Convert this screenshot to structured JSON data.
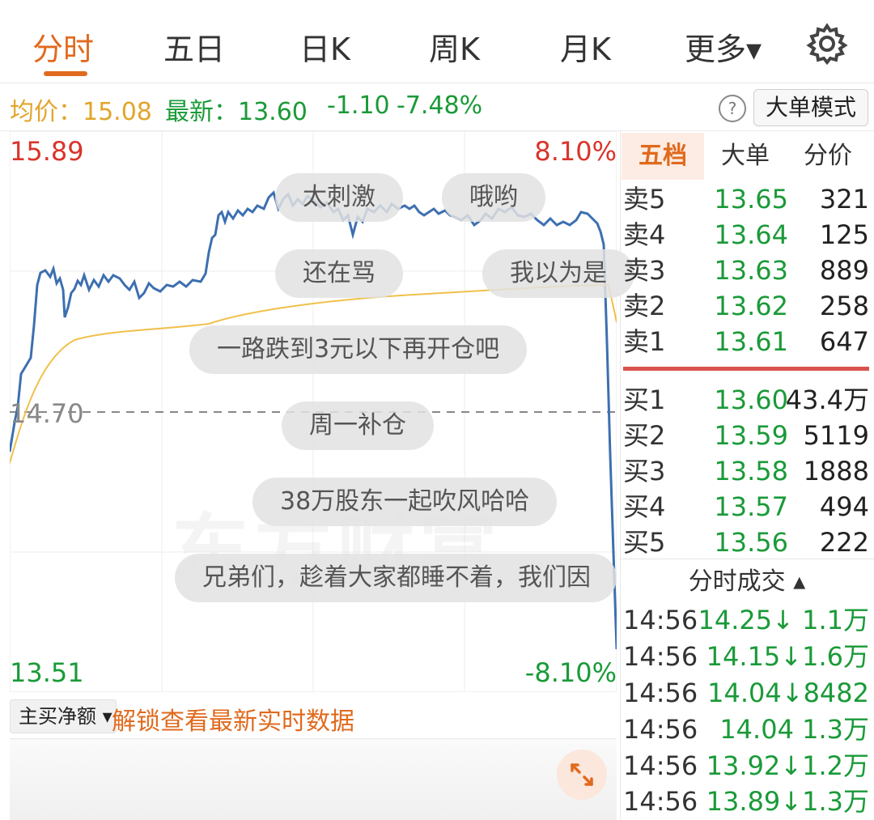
{
  "tabs": [
    {
      "label": "分时",
      "active": true
    },
    {
      "label": "五日"
    },
    {
      "label": "日K"
    },
    {
      "label": "周K"
    },
    {
      "label": "月K"
    },
    {
      "label": "更多▾"
    }
  ],
  "info": {
    "avg_label": "均价：15.08",
    "latest_label": "最新：13.60",
    "change": "-1.10",
    "change_pct": "-7.48%",
    "help": "?",
    "big_order_mode": "大单模式"
  },
  "chart": {
    "price_high": "15.89",
    "pct_high": "8.10%",
    "price_mid": "14.70",
    "price_low": "13.51",
    "pct_low": "-8.10%",
    "watermark": "东方财富",
    "colors": {
      "price_line": "#3d6fb0",
      "avg_line": "#f0c04a",
      "up": "#d9342b",
      "down": "#1a9a38"
    }
  },
  "danmu": [
    "太刺激",
    "哦哟",
    "还在骂",
    "我以为是",
    "一路跌到3元以下再开仓吧",
    "周一补仓",
    "38万股东一起吹风哈哈",
    "兄弟们，趁着大家都睡不着，我们因"
  ],
  "bottom": {
    "net_buy_label": "主买净额 ▾",
    "unlock_text": "解锁查看最新实时数据"
  },
  "right_tabs": [
    {
      "label": "五档",
      "active": true
    },
    {
      "label": "大单"
    },
    {
      "label": "分价"
    }
  ],
  "sell_orders": [
    {
      "label": "卖5",
      "price": "13.65",
      "vol": "321"
    },
    {
      "label": "卖4",
      "price": "13.64",
      "vol": "125"
    },
    {
      "label": "卖3",
      "price": "13.63",
      "vol": "889"
    },
    {
      "label": "卖2",
      "price": "13.62",
      "vol": "258"
    },
    {
      "label": "卖1",
      "price": "13.61",
      "vol": "647"
    }
  ],
  "buy_orders": [
    {
      "label": "买1",
      "price": "13.60",
      "vol": "43.4万"
    },
    {
      "label": "买2",
      "price": "13.59",
      "vol": "5119"
    },
    {
      "label": "买3",
      "price": "13.58",
      "vol": "1888"
    },
    {
      "label": "买4",
      "price": "13.57",
      "vol": "494"
    },
    {
      "label": "买5",
      "price": "13.56",
      "vol": "222"
    }
  ],
  "trades_title": "分时成交 ▴",
  "trades": [
    {
      "time": "14:56",
      "detail": "14.25↓ 1.1万"
    },
    {
      "time": "14:56",
      "detail": "14.15↓1.6万"
    },
    {
      "time": "14:56",
      "detail": "14.04↓8482"
    },
    {
      "time": "14:56",
      "detail": "14.04  1.3万"
    },
    {
      "time": "14:56",
      "detail": "13.92↓1.2万"
    },
    {
      "time": "14:56",
      "detail": "13.89↓1.3万"
    }
  ]
}
